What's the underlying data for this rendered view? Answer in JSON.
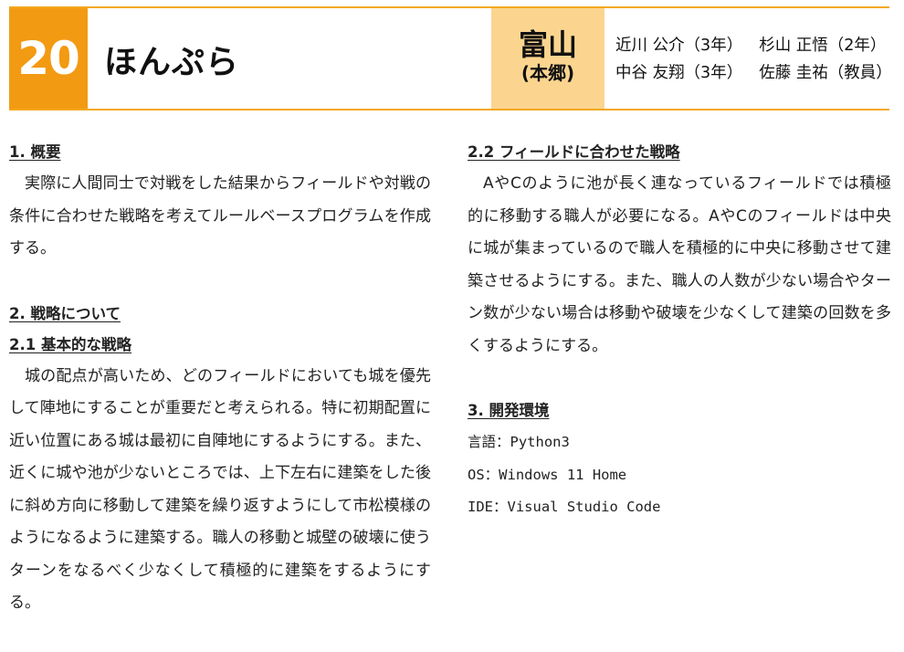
{
  "header": {
    "number": "20",
    "team_name": "ほんぷら",
    "region": "富山",
    "region_sub": "(本郷)",
    "members": [
      [
        "近川 公介（3年）",
        "杉山 正悟（2年）"
      ],
      [
        "中谷 友翔（3年）",
        "佐藤 圭祐（教員）"
      ]
    ]
  },
  "sections": {
    "overview_heading": "1. 概要",
    "overview_text": "実際に人間同士で対戦をした結果からフィールドや対戦の条件に合わせた戦略を考えてルールベースプログラムを作成する。",
    "strategy_heading": "2. 戦略について",
    "basic_heading": "2.1 基本的な戦略",
    "basic_text": "城の配点が高いため、どのフィールドにおいても城を優先して陣地にすることが重要だと考えられる。特に初期配置に近い位置にある城は最初に自陣地にするようにする。また、近くに城や池が少ないところでは、上下左右に建築をした後に斜め方向に移動して建築を繰り返すようにして市松模様のようになるように建築する。職人の移動と城壁の破壊に使うターンをなるべく少なくして積極的に建築をするようにする。",
    "field_heading": "2.2 フィールドに合わせた戦略",
    "field_text": "AやCのように池が長く連なっているフィールドでは積極的に移動する職人が必要になる。AやCのフィールドは中央に城が集まっているので職人を積極的に中央に移動させて建築させるようにする。また、職人の人数が少ない場合やターン数が少ない場合は移動や破壊を少なくして建築の回数を多くするようにする。",
    "env_heading": "3. 開発環境",
    "env_lines": [
      "言語：Python3",
      "OS：Windows 11 Home",
      "IDE：Visual Studio Code"
    ]
  },
  "colors": {
    "accent_orange": "#f39a13",
    "region_bg": "#fbd58f",
    "rule": "#f3a81d"
  }
}
